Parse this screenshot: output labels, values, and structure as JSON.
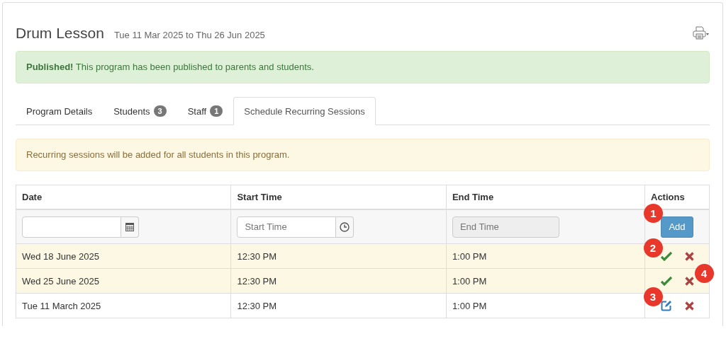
{
  "header": {
    "title": "Drum Lesson",
    "subtitle": "Tue 11 Mar 2025 to Thu 26 Jun 2025"
  },
  "success_alert": {
    "heading": "Published!",
    "text": "This program has been published to parents and students."
  },
  "tabs": [
    {
      "label": "Program Details",
      "selected": false
    },
    {
      "label": "Students",
      "badge": "3",
      "selected": false
    },
    {
      "label": "Staff",
      "badge": "1",
      "selected": false
    },
    {
      "label": "Schedule Recurring Sessions",
      "selected": true
    }
  ],
  "warning_alert": "Recurring sessions will be added for all students in this program.",
  "table": {
    "columns": [
      "Date",
      "Start Time",
      "End Time",
      "Actions"
    ],
    "input_row": {
      "start": {
        "placeholder": "Start Time"
      },
      "end": {
        "placeholder": "End Time",
        "disabled": true
      },
      "button": {
        "label": "Add",
        "callout": "1"
      }
    },
    "rows": [
      {
        "date": "Wed 18 June 2025",
        "start": "12:30 PM",
        "end": "1:00 PM",
        "highlighted": true,
        "actions": [
          {
            "kind": "confirm",
            "callout": "2"
          },
          {
            "kind": "delete"
          }
        ]
      },
      {
        "date": "Wed 25 June 2025",
        "start": "12:30 PM",
        "end": "1:00 PM",
        "highlighted": true,
        "actions": [
          {
            "kind": "confirm"
          },
          {
            "kind": "delete",
            "callout": "4"
          }
        ]
      },
      {
        "date": "Tue 11 March 2025",
        "start": "12:30 PM",
        "end": "1:00 PM",
        "highlighted": false,
        "actions": [
          {
            "kind": "edit",
            "callout": "3"
          },
          {
            "kind": "delete"
          }
        ]
      }
    ]
  }
}
